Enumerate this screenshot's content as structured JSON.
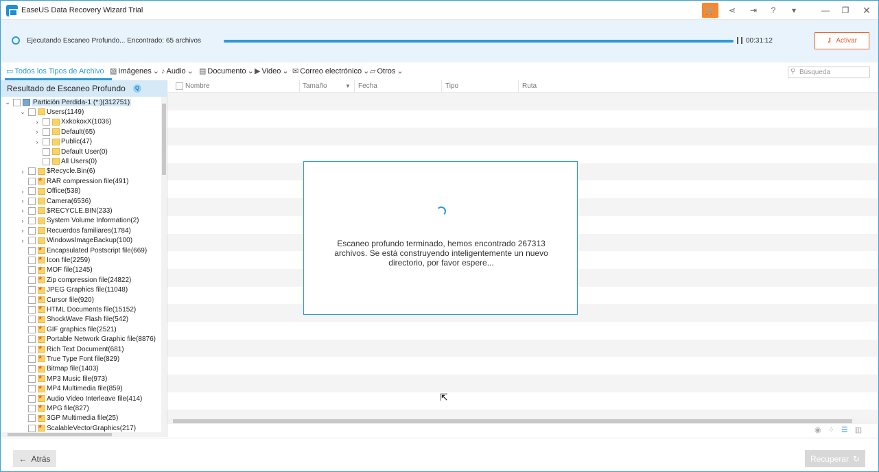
{
  "window": {
    "title": "EaseUS Data Recovery Wizard Trial",
    "controls": {
      "minimize": "—",
      "maximize": "❐",
      "close": "✕"
    }
  },
  "scan": {
    "status": "Ejecutando Escaneo Profundo... Encontrado: 65 archivos",
    "progress_percent": 100,
    "elapsed": "00:31:12",
    "activate_label": "Activar"
  },
  "filters": {
    "tabs": [
      {
        "label": "Todos los Tipos de Archivo",
        "icon": "monitor-icon",
        "active": true
      },
      {
        "label": "Imágenes",
        "icon": "image-icon"
      },
      {
        "label": "Audio",
        "icon": "music-icon"
      },
      {
        "label": "Documento",
        "icon": "document-icon"
      },
      {
        "label": "Video",
        "icon": "video-icon"
      },
      {
        "label": "Correo electrónico",
        "icon": "mail-icon"
      },
      {
        "label": "Otros",
        "icon": "folder-icon"
      }
    ],
    "search_placeholder": "Búsqueda"
  },
  "tree": {
    "title": "Resultado de Escaneo Profundo",
    "nodes": [
      {
        "label": "Partición Perdida-1 (*:)(312751)",
        "depth": 0,
        "expanded": true,
        "icon": "drive",
        "selected": true
      },
      {
        "label": "Users(1149)",
        "depth": 1,
        "expanded": true,
        "icon": "folder"
      },
      {
        "label": "XxkokoxX(1036)",
        "depth": 2,
        "collapsed": true,
        "icon": "folder"
      },
      {
        "label": "Default(65)",
        "depth": 2,
        "collapsed": true,
        "icon": "folder"
      },
      {
        "label": "Public(47)",
        "depth": 2,
        "collapsed": true,
        "icon": "folder"
      },
      {
        "label": "Default User(0)",
        "depth": 2,
        "icon": "folder"
      },
      {
        "label": "All Users(0)",
        "depth": 2,
        "icon": "folder"
      },
      {
        "label": "$Recycle.Bin(6)",
        "depth": 1,
        "collapsed": true,
        "icon": "folder"
      },
      {
        "label": "RAR compression file(491)",
        "depth": 1,
        "icon": "type"
      },
      {
        "label": "Office(538)",
        "depth": 1,
        "collapsed": true,
        "icon": "folder"
      },
      {
        "label": "Camera(6536)",
        "depth": 1,
        "collapsed": true,
        "icon": "folder"
      },
      {
        "label": "$RECYCLE.BIN(233)",
        "depth": 1,
        "collapsed": true,
        "icon": "folder"
      },
      {
        "label": "System Volume Information(2)",
        "depth": 1,
        "collapsed": true,
        "icon": "folder"
      },
      {
        "label": "Recuerdos familiares(1784)",
        "depth": 1,
        "collapsed": true,
        "icon": "folder"
      },
      {
        "label": "WindowsImageBackup(100)",
        "depth": 1,
        "collapsed": true,
        "icon": "folder"
      },
      {
        "label": "Encapsulated Postscript file(669)",
        "depth": 1,
        "icon": "type"
      },
      {
        "label": "Icon file(2259)",
        "depth": 1,
        "icon": "type"
      },
      {
        "label": "MOF file(1245)",
        "depth": 1,
        "icon": "type"
      },
      {
        "label": "Zip compression file(24822)",
        "depth": 1,
        "icon": "type"
      },
      {
        "label": "JPEG Graphics file(11048)",
        "depth": 1,
        "icon": "type"
      },
      {
        "label": "Cursor file(920)",
        "depth": 1,
        "icon": "type"
      },
      {
        "label": "HTML Documents file(15152)",
        "depth": 1,
        "icon": "type"
      },
      {
        "label": "ShockWave Flash file(542)",
        "depth": 1,
        "icon": "type"
      },
      {
        "label": "GIF graphics file(2521)",
        "depth": 1,
        "icon": "type"
      },
      {
        "label": "Portable Network Graphic file(8876)",
        "depth": 1,
        "icon": "type"
      },
      {
        "label": "Rich Text Document(681)",
        "depth": 1,
        "icon": "type"
      },
      {
        "label": "True Type Font file(829)",
        "depth": 1,
        "icon": "type"
      },
      {
        "label": "Bitmap file(1403)",
        "depth": 1,
        "icon": "type"
      },
      {
        "label": "MP3 Music file(973)",
        "depth": 1,
        "icon": "type"
      },
      {
        "label": "MP4 Multimedia file(859)",
        "depth": 1,
        "icon": "type"
      },
      {
        "label": "Audio Video Interleave file(414)",
        "depth": 1,
        "icon": "type"
      },
      {
        "label": "MPG file(827)",
        "depth": 1,
        "icon": "type"
      },
      {
        "label": "3GP Multimedia file(25)",
        "depth": 1,
        "icon": "type"
      },
      {
        "label": "ScalableVectorGraphics(217)",
        "depth": 1,
        "icon": "type"
      }
    ]
  },
  "list": {
    "columns": [
      "Nombre",
      "Tamaño",
      "Fecha",
      "Tipo",
      "Ruta"
    ]
  },
  "modal": {
    "message": "Escaneo profundo terminado, hemos encontrado 267313 archivos. Se está construyendo inteligentemente un nuevo directorio, por favor espere..."
  },
  "footer": {
    "back_label": "Atrás",
    "recover_label": "Recuperar"
  },
  "colors": {
    "accent": "#2d9ad6",
    "activate": "#e8622c",
    "cart": "#f7882f"
  }
}
